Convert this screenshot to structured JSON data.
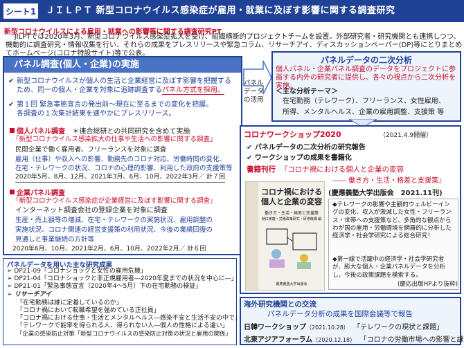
{
  "header": {
    "sheet_tag": "シート1",
    "title": "ＪＩＬＰＴ 新型コロナウイルス感染症が雇用・就業に及ぼす影響に関する調査研究"
  },
  "project": {
    "heading": "新型コロナウイルスによる雇用・就業への影響等に関する調査研究PT",
    "body": "JILPTでは2020年3月、新型コロナウイルス感染症拡大を受け、組織横断的プロジェクトチームを設置。外部研究者・研究機関とも連携しつつ、機動的に調査研究・情報収集を行い、それらの成果をプレスリリースや緊急コラム、リサーチアイ、ディスカッションペーパー(DP)等にとりまとめてホームページ(コロナ特設サイト)等で公表。"
  },
  "panel": {
    "heading": "パネル調査(個人・企業)の実施",
    "point1_a": "新型コロナウイルスが個人の生活と企業経営に及ぼす影響を把握する",
    "point1_b": "ため、同一の個人・企業を対象に追跡調査する",
    "point1_c": "パネル方式を採用。",
    "point2_a": "第１回 緊急事態宣言の発出前～現在に至るまでの変化を把握。",
    "point2_b": "各調査の１次集計結果を速やかにプレスリリース。",
    "individual": {
      "title": "個人パネル調査",
      "note": "＊連合総研との共同研究を含めて実施",
      "subtitle": "「新型コロナウイルス感染拡大の仕事や生活への影響に関する調査」",
      "target": "民間企業で働く雇用者、フリーランスを対象に調査",
      "content_a": "雇用（仕事）や収入への影響、勤務先のコロナ対応、労働時間の変化、",
      "content_b": "在宅・テレワークの状況、コロナの心理的影響、利用した政府の支援策等",
      "dates": "2020年5月、8月、12月、2021年3月、6月、10月、2022年3月／ 計７回"
    },
    "company": {
      "title": "企業パネル調査",
      "subtitle": "「新型コロナウイルス感染症が企業経営に及ぼす影響に関する調査」",
      "target": "インターネット調査会社の登録企業を対象に調査",
      "content_a": "生産・売上額等の増減、在宅・テレワークの実施状況、雇用調整の",
      "content_b": "実施状況、コロナ関連の経営支援策の利用状況、今後の業績回復の",
      "content_c": "見通しと事業継続の方針等",
      "dates": "2020年6月、10月、2021年2月、6月、10月、2022年2月／ 計６回"
    }
  },
  "arrow_label": "パネルデータの活用",
  "secondary": {
    "title": "パネルデータの二次分析",
    "body": "個人パネル・企業パネル調査のデータをプロジェクトに参画する内外の研究者に提供し、各々の視点から二次分析を実施。",
    "themes_head": "＜主な分析テーマ＞",
    "themes_a": "在宅勤務（テレワーク）、フリーランス、女性雇用、",
    "themes_b": "所得、メンタルヘルス、企業の雇用調整、支援策 等"
  },
  "workshop": {
    "title": "コロナワークショップ2020",
    "date": "（2021.4.9開催）",
    "item1": "パネルデータの二次分析の研究報告",
    "item2": "ワークショップの成果を書籍化",
    "book_label": "書籍刊行",
    "book_title": "『コロナ禍における個人と企業の変容",
    "book_subtitle": "―― 働き方・生活・格差と支援策』",
    "publisher": "(慶應義塾大学出版会　2021.11刊)",
    "cover_title_a": "コロナ禍における",
    "cover_title_b": "個人と企業の変容",
    "cover_sub": "働き方・生活・格差と支援策",
    "cover_editors": "樋口美雄・労働政策研究・研修機構 編",
    "cover_publisher": "慶應義塾大学出版会",
    "info_1": "◆テレワークの影響や主観的ウェルビーイングの変化、収入が激減した女性・フリーランス・世帯への支援策など、多角的な観点からわが国の雇用・労働環境を網羅的に分析した経済学・社会学研究による総合研究！",
    "info_2": "◆第一線で活躍中の経済学・社会学研究者が、膨大な個人・企業パネルデータを分析し、今後の政策課題を模索する。",
    "info_source": "(慶応出版HPより抜粋)"
  },
  "research": {
    "heading": "パネルデータを用いた主な研究成果",
    "items": [
      "DP21-09「コロナショックと女性の雇用危機」",
      "DP21-04「コロナショックと非正規雇用者―2020年夏までの状況を中心に―」",
      "DP21-01「緊急事態宣言（2020年4～5月）下の在宅勤務の検証」"
    ],
    "research_eye_label": "リサーチアイ",
    "research_eye": [
      "「在宅勤務は誰に定着しているのか」",
      "「コロナ禍において転職希望を強めている正社員」",
      "「コロナ禍における仕事・生活とメンタルヘルス―感染不安と生活不安の中で」",
      "「テレワークで能率を得られる人、得られない人―個人の性格による違い」",
      "「企業の感染防止対策「新型コロナウイルスの感染防止対策の状況と雇用の関係」"
    ]
  },
  "intl": {
    "title": "海外研究機関との交流",
    "subtitle": "パネルデータ分析の成果を国際会議等で報告",
    "row1_name": "日韓ワークショップ",
    "row1_date": "（2021.10.28）",
    "row1_theme": "「テレワークの現状と課題」",
    "row2_name": "北東アジアフォーラム",
    "row2_date": "（2020.12.18）",
    "row2_theme": "「コロナの労働市場への影響と課題」"
  },
  "colors": {
    "primary_blue": "#1f4196",
    "accent_red": "#c8102e",
    "header_light_blue": "#4a73c6"
  }
}
